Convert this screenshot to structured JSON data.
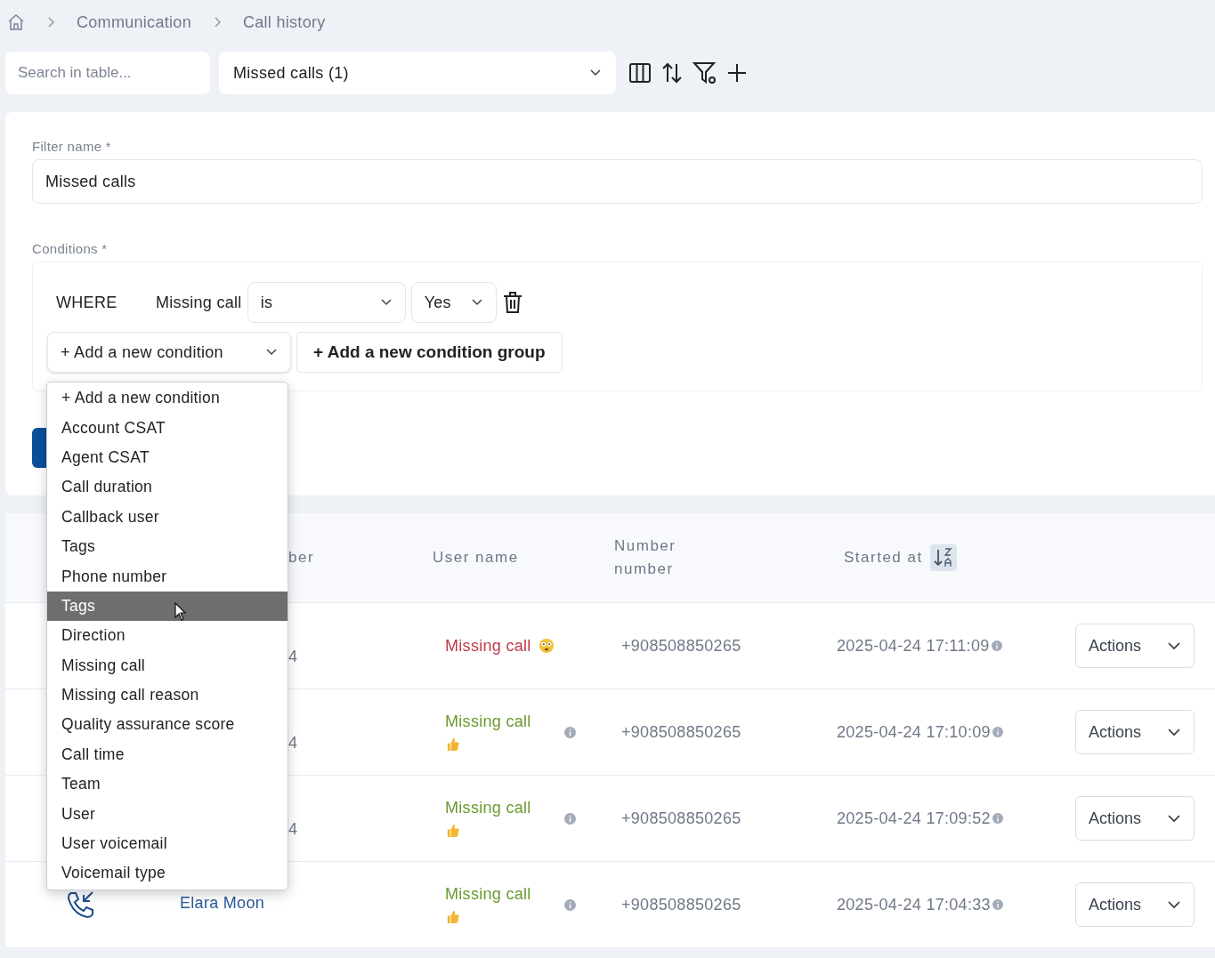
{
  "breadcrumb": [
    "Communication",
    "Call history"
  ],
  "toolbar": {
    "search": {
      "placeholder": "Search in table..."
    },
    "filter_select": {
      "value": "Missed calls (1)"
    }
  },
  "filter_form": {
    "name_label": "Filter name *",
    "name_value": "Missed calls",
    "conditions_label": "Conditions *",
    "condition": {
      "where": "WHERE",
      "field": "Missing call",
      "operator": "is",
      "value": "Yes"
    },
    "add_condition": "+ Add a new condition",
    "add_group": "+ Add a new condition group",
    "dropdown": {
      "items": [
        {
          "label": "+ Add a new condition",
          "selected": false
        },
        {
          "label": "Account CSAT",
          "selected": false
        },
        {
          "label": "Agent CSAT",
          "selected": false
        },
        {
          "label": "Call duration",
          "selected": false
        },
        {
          "label": "Callback user",
          "selected": false
        },
        {
          "label": "Tags",
          "selected": false
        },
        {
          "label": "Phone number",
          "selected": false
        },
        {
          "label": "Tags",
          "selected": true
        },
        {
          "label": "Direction",
          "selected": false
        },
        {
          "label": "Missing call",
          "selected": false
        },
        {
          "label": "Missing call reason",
          "selected": false
        },
        {
          "label": "Quality assurance score",
          "selected": false
        },
        {
          "label": "Call time",
          "selected": false
        },
        {
          "label": "Team",
          "selected": false
        },
        {
          "label": "User",
          "selected": false
        },
        {
          "label": "User voicemail",
          "selected": false
        },
        {
          "label": "Voicemail type",
          "selected": false
        }
      ]
    }
  },
  "table": {
    "columns": [
      "ber",
      "User name",
      "Number number",
      "Started at"
    ],
    "rows": [
      {
        "phone_fragment": "4",
        "user_name": "Missing call",
        "kind": "alert",
        "color": "#c0394b",
        "number": "+908508850265",
        "started_at": "2025-04-24 17:11:09",
        "action": "Actions"
      },
      {
        "phone_fragment": "4",
        "user_name": "Missing call",
        "kind": "ok",
        "color": "#6a9a2e",
        "number": "+908508850265",
        "started_at": "2025-04-24 17:10:09",
        "action": "Actions"
      },
      {
        "phone_fragment": "4",
        "user_name": "Missing call",
        "kind": "ok",
        "color": "#6a9a2e",
        "number": "+908508850265",
        "started_at": "2025-04-24 17:09:52",
        "action": "Actions"
      },
      {
        "caller": "Elara Moon",
        "user_name": "Missing call",
        "kind": "ok",
        "color": "#6a9a2e",
        "number": "+908508850265",
        "started_at": "2025-04-24 17:04:33",
        "action": "Actions"
      }
    ]
  }
}
